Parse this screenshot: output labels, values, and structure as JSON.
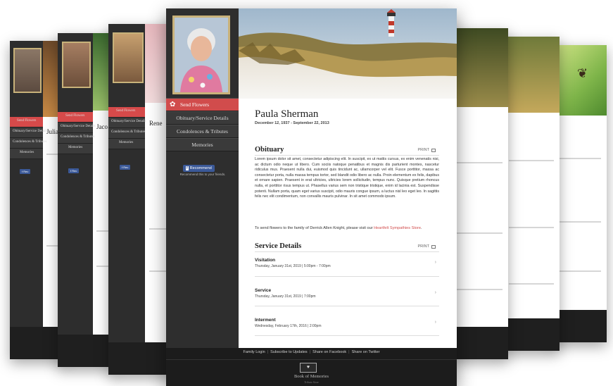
{
  "main": {
    "sidebar": {
      "send_flowers": "Send Flowers",
      "nav": [
        "Obituary/Service Details",
        "Condolences & Tributes",
        "Memories"
      ],
      "facebook_button": "Recommend",
      "facebook_caption": "Recommend this to your friends."
    },
    "name": "Paula Sherman",
    "dates": "December 12, 1937 - September 22, 2013",
    "obituary": {
      "title": "Obituary",
      "print": "PRINT",
      "text": "Lorem ipsum dolor sit amet, consectetur adipiscing elit. In suscipit, ex ut mattis cursus, ex enim venenatis nisi, ac dictum odio neque ut libero. Cum sociis natoque penatibus et magnis dis parturient montes, nascetur ridiculus mus. Praesent nulla dui, euismod quis tincidunt ac, ullamcorper vel elit. Fusce porttitor, massa ac consectetur porta, nulla massa tempus tortor, sed blandit odio libero ac nulla. Proin elementum ex felis, dapibus et ornare sapien. Praesent in erat ultricies, ultricies lorem sollicitudin, tempus nunc. Quisque pretium rhoncus nulla, et porttitor risus tempus ut. Phasellus varius sem non tristique tristique, enim id lacinia est. Suspendisse potenti. Nullam porta, quam eget varius suscipit, odio mauris congue ipsum, a luctus nisl leo eget leo. In sagittis felis nec elit condimentum, non convallis mauris pulvinar. In sit amet commodo ipsum.",
      "send_prefix": "To send flowers to the family of Derrick Allen Knight, please visit our",
      "send_link": "Heartfelt Sympathies Store",
      "send_suffix": "."
    },
    "services": {
      "title": "Service Details",
      "print": "PRINT",
      "items": [
        {
          "title": "Visitation",
          "date": "Thursday, January 31st, 2019 | 5:00pm - 7:00pm"
        },
        {
          "title": "Service",
          "date": "Thursday, January 31st, 2019 | 7:00pm"
        },
        {
          "title": "Interment",
          "date": "Wednesday, February 17th, 2016 | 2:00pm"
        }
      ]
    },
    "footer": {
      "links": [
        "Family Login",
        "Subscribe to Updates",
        "Share on Facebook",
        "Share on Twitter"
      ],
      "brand": "Book of Memories",
      "brand_sub": "Tribute Store"
    }
  },
  "background_pages": {
    "left_names": [
      "Julia",
      "Jaco",
      "Rene"
    ],
    "labels": [
      "Send Flowers",
      "Obituary/Service Details",
      "Condolences & Tributes",
      "Memories"
    ]
  },
  "colors": {
    "accent": "#d14c4c",
    "sidebar": "#2e2e2e",
    "footer": "#1c1c1c",
    "frame": "#c9b27a"
  }
}
